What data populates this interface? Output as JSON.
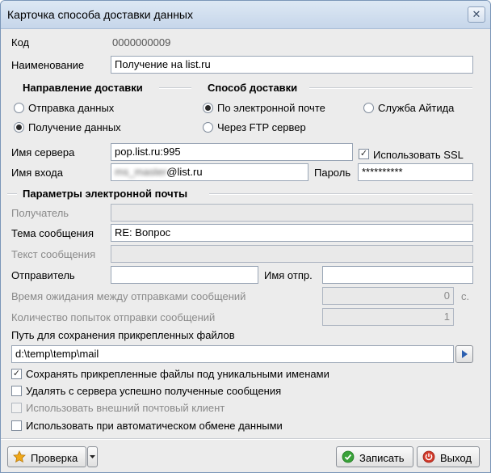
{
  "window": {
    "title": "Карточка способа доставки данных",
    "close_glyph": "✕"
  },
  "code": {
    "label": "Код",
    "value": "0000000009"
  },
  "name": {
    "label": "Наименование",
    "value": "Получение на list.ru"
  },
  "direction": {
    "title": "Направление доставки",
    "options": [
      {
        "label": "Отправка данных",
        "selected": false
      },
      {
        "label": "Получение данных",
        "selected": true
      }
    ]
  },
  "method": {
    "title": "Способ доставки",
    "options": [
      {
        "label": "По электронной почте",
        "selected": true
      },
      {
        "label": "Служба Айтида",
        "selected": false
      },
      {
        "label": "Через FTP сервер",
        "selected": false
      }
    ]
  },
  "server": {
    "label": "Имя сервера",
    "value": "pop.list.ru:995"
  },
  "ssl": {
    "label": "Использовать SSL",
    "checked": true
  },
  "login": {
    "label": "Имя входа",
    "value_hidden": "ms_master",
    "value_domain": "@list.ru"
  },
  "password": {
    "label": "Пароль",
    "value": "**********"
  },
  "email_section": {
    "title": "Параметры электронной почты",
    "recipient_label": "Получатель",
    "recipient_value": "",
    "subject_label": "Тема сообщения",
    "subject_value": "RE: Вопрос",
    "body_label": "Текст сообщения",
    "body_value": "",
    "sender_label": "Отправитель",
    "sender_value": "",
    "sender_name_label": "Имя отпр.",
    "sender_name_value": "",
    "wait_label": "Время ожидания между отправками сообщений",
    "wait_value": "0",
    "wait_unit": "с.",
    "attempts_label": "Количество попыток отправки сообщений",
    "attempts_value": "1",
    "path_label": "Путь для сохранения прикрепленных файлов",
    "path_value": "d:\\temp\\temp\\mail"
  },
  "options": [
    {
      "label": "Сохранять прикрепленные файлы под уникальными именами",
      "checked": true,
      "enabled": true
    },
    {
      "label": "Удалять с сервера успешно полученные сообщения",
      "checked": false,
      "enabled": true
    },
    {
      "label": "Использовать внешний почтовый клиент",
      "checked": false,
      "enabled": false
    },
    {
      "label": "Использовать при автоматическом обмене данными",
      "checked": false,
      "enabled": true
    }
  ],
  "buttons": {
    "check": "Проверка",
    "save": "Записать",
    "exit": "Выход"
  },
  "icons": {
    "check": "star-icon",
    "save": "ok-circle-icon",
    "exit": "power-icon",
    "browse": "arrow-right-icon",
    "dropdown": "chevron-down-icon"
  },
  "colors": {
    "title_bar": "#c6d6ea",
    "window_bg": "#ececec",
    "save_icon": "#3aa23a",
    "exit_icon": "#d23a2a",
    "star_icon": "#f0a818"
  }
}
